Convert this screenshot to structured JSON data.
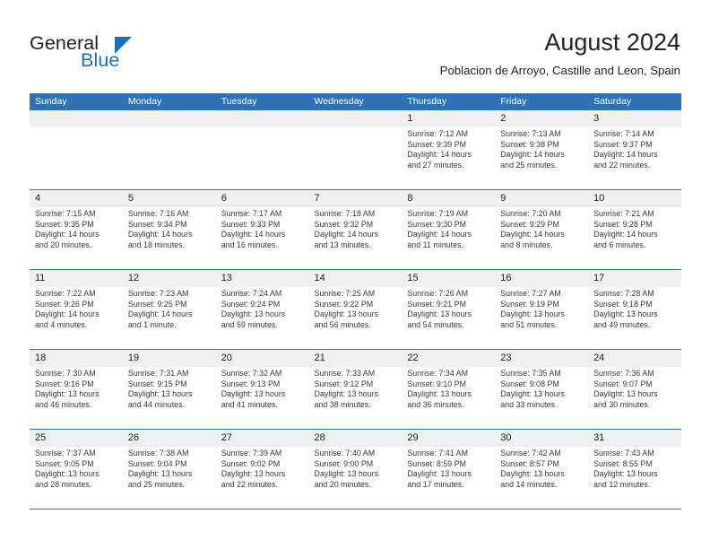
{
  "brand": {
    "name_part1": "General",
    "name_part2": "Blue",
    "triangle_icon": "triangle-icon",
    "accent_color": "#1673bd"
  },
  "header": {
    "title": "August 2024",
    "subtitle": "Poblacion de Arroyo, Castille and Leon, Spain"
  },
  "theme": {
    "header_blue": "#2e71b5",
    "date_band_gray": "#f0f0f0",
    "text_color": "#3a3a3a"
  },
  "calendar": {
    "weekday_headers": [
      "Sunday",
      "Monday",
      "Tuesday",
      "Wednesday",
      "Thursday",
      "Friday",
      "Saturday"
    ],
    "weeks": [
      {
        "dates": [
          "",
          "",
          "",
          "",
          "1",
          "2",
          "3"
        ],
        "cells": [
          {
            "empty": true
          },
          {
            "empty": true
          },
          {
            "empty": true
          },
          {
            "empty": true
          },
          {
            "sunrise": "Sunrise: 7:12 AM",
            "sunset": "Sunset: 9:39 PM",
            "daylight1": "Daylight: 14 hours",
            "daylight2": "and 27 minutes."
          },
          {
            "sunrise": "Sunrise: 7:13 AM",
            "sunset": "Sunset: 9:38 PM",
            "daylight1": "Daylight: 14 hours",
            "daylight2": "and 25 minutes."
          },
          {
            "sunrise": "Sunrise: 7:14 AM",
            "sunset": "Sunset: 9:37 PM",
            "daylight1": "Daylight: 14 hours",
            "daylight2": "and 22 minutes."
          }
        ]
      },
      {
        "dates": [
          "4",
          "5",
          "6",
          "7",
          "8",
          "9",
          "10"
        ],
        "cells": [
          {
            "sunrise": "Sunrise: 7:15 AM",
            "sunset": "Sunset: 9:35 PM",
            "daylight1": "Daylight: 14 hours",
            "daylight2": "and 20 minutes."
          },
          {
            "sunrise": "Sunrise: 7:16 AM",
            "sunset": "Sunset: 9:34 PM",
            "daylight1": "Daylight: 14 hours",
            "daylight2": "and 18 minutes."
          },
          {
            "sunrise": "Sunrise: 7:17 AM",
            "sunset": "Sunset: 9:33 PM",
            "daylight1": "Daylight: 14 hours",
            "daylight2": "and 16 minutes."
          },
          {
            "sunrise": "Sunrise: 7:18 AM",
            "sunset": "Sunset: 9:32 PM",
            "daylight1": "Daylight: 14 hours",
            "daylight2": "and 13 minutes."
          },
          {
            "sunrise": "Sunrise: 7:19 AM",
            "sunset": "Sunset: 9:30 PM",
            "daylight1": "Daylight: 14 hours",
            "daylight2": "and 11 minutes."
          },
          {
            "sunrise": "Sunrise: 7:20 AM",
            "sunset": "Sunset: 9:29 PM",
            "daylight1": "Daylight: 14 hours",
            "daylight2": "and 8 minutes."
          },
          {
            "sunrise": "Sunrise: 7:21 AM",
            "sunset": "Sunset: 9:28 PM",
            "daylight1": "Daylight: 14 hours",
            "daylight2": "and 6 minutes."
          }
        ]
      },
      {
        "dates": [
          "11",
          "12",
          "13",
          "14",
          "15",
          "16",
          "17"
        ],
        "cells": [
          {
            "sunrise": "Sunrise: 7:22 AM",
            "sunset": "Sunset: 9:26 PM",
            "daylight1": "Daylight: 14 hours",
            "daylight2": "and 4 minutes."
          },
          {
            "sunrise": "Sunrise: 7:23 AM",
            "sunset": "Sunset: 9:25 PM",
            "daylight1": "Daylight: 14 hours",
            "daylight2": "and 1 minute."
          },
          {
            "sunrise": "Sunrise: 7:24 AM",
            "sunset": "Sunset: 9:24 PM",
            "daylight1": "Daylight: 13 hours",
            "daylight2": "and 59 minutes."
          },
          {
            "sunrise": "Sunrise: 7:25 AM",
            "sunset": "Sunset: 9:22 PM",
            "daylight1": "Daylight: 13 hours",
            "daylight2": "and 56 minutes."
          },
          {
            "sunrise": "Sunrise: 7:26 AM",
            "sunset": "Sunset: 9:21 PM",
            "daylight1": "Daylight: 13 hours",
            "daylight2": "and 54 minutes."
          },
          {
            "sunrise": "Sunrise: 7:27 AM",
            "sunset": "Sunset: 9:19 PM",
            "daylight1": "Daylight: 13 hours",
            "daylight2": "and 51 minutes."
          },
          {
            "sunrise": "Sunrise: 7:28 AM",
            "sunset": "Sunset: 9:18 PM",
            "daylight1": "Daylight: 13 hours",
            "daylight2": "and 49 minutes."
          }
        ]
      },
      {
        "dates": [
          "18",
          "19",
          "20",
          "21",
          "22",
          "23",
          "24"
        ],
        "cells": [
          {
            "sunrise": "Sunrise: 7:30 AM",
            "sunset": "Sunset: 9:16 PM",
            "daylight1": "Daylight: 13 hours",
            "daylight2": "and 46 minutes."
          },
          {
            "sunrise": "Sunrise: 7:31 AM",
            "sunset": "Sunset: 9:15 PM",
            "daylight1": "Daylight: 13 hours",
            "daylight2": "and 44 minutes."
          },
          {
            "sunrise": "Sunrise: 7:32 AM",
            "sunset": "Sunset: 9:13 PM",
            "daylight1": "Daylight: 13 hours",
            "daylight2": "and 41 minutes."
          },
          {
            "sunrise": "Sunrise: 7:33 AM",
            "sunset": "Sunset: 9:12 PM",
            "daylight1": "Daylight: 13 hours",
            "daylight2": "and 38 minutes."
          },
          {
            "sunrise": "Sunrise: 7:34 AM",
            "sunset": "Sunset: 9:10 PM",
            "daylight1": "Daylight: 13 hours",
            "daylight2": "and 36 minutes."
          },
          {
            "sunrise": "Sunrise: 7:35 AM",
            "sunset": "Sunset: 9:08 PM",
            "daylight1": "Daylight: 13 hours",
            "daylight2": "and 33 minutes."
          },
          {
            "sunrise": "Sunrise: 7:36 AM",
            "sunset": "Sunset: 9:07 PM",
            "daylight1": "Daylight: 13 hours",
            "daylight2": "and 30 minutes."
          }
        ]
      },
      {
        "dates": [
          "25",
          "26",
          "27",
          "28",
          "29",
          "30",
          "31"
        ],
        "cells": [
          {
            "sunrise": "Sunrise: 7:37 AM",
            "sunset": "Sunset: 9:05 PM",
            "daylight1": "Daylight: 13 hours",
            "daylight2": "and 28 minutes."
          },
          {
            "sunrise": "Sunrise: 7:38 AM",
            "sunset": "Sunset: 9:04 PM",
            "daylight1": "Daylight: 13 hours",
            "daylight2": "and 25 minutes."
          },
          {
            "sunrise": "Sunrise: 7:39 AM",
            "sunset": "Sunset: 9:02 PM",
            "daylight1": "Daylight: 13 hours",
            "daylight2": "and 22 minutes."
          },
          {
            "sunrise": "Sunrise: 7:40 AM",
            "sunset": "Sunset: 9:00 PM",
            "daylight1": "Daylight: 13 hours",
            "daylight2": "and 20 minutes."
          },
          {
            "sunrise": "Sunrise: 7:41 AM",
            "sunset": "Sunset: 8:59 PM",
            "daylight1": "Daylight: 13 hours",
            "daylight2": "and 17 minutes."
          },
          {
            "sunrise": "Sunrise: 7:42 AM",
            "sunset": "Sunset: 8:57 PM",
            "daylight1": "Daylight: 13 hours",
            "daylight2": "and 14 minutes."
          },
          {
            "sunrise": "Sunrise: 7:43 AM",
            "sunset": "Sunset: 8:55 PM",
            "daylight1": "Daylight: 13 hours",
            "daylight2": "and 12 minutes."
          }
        ]
      }
    ]
  }
}
